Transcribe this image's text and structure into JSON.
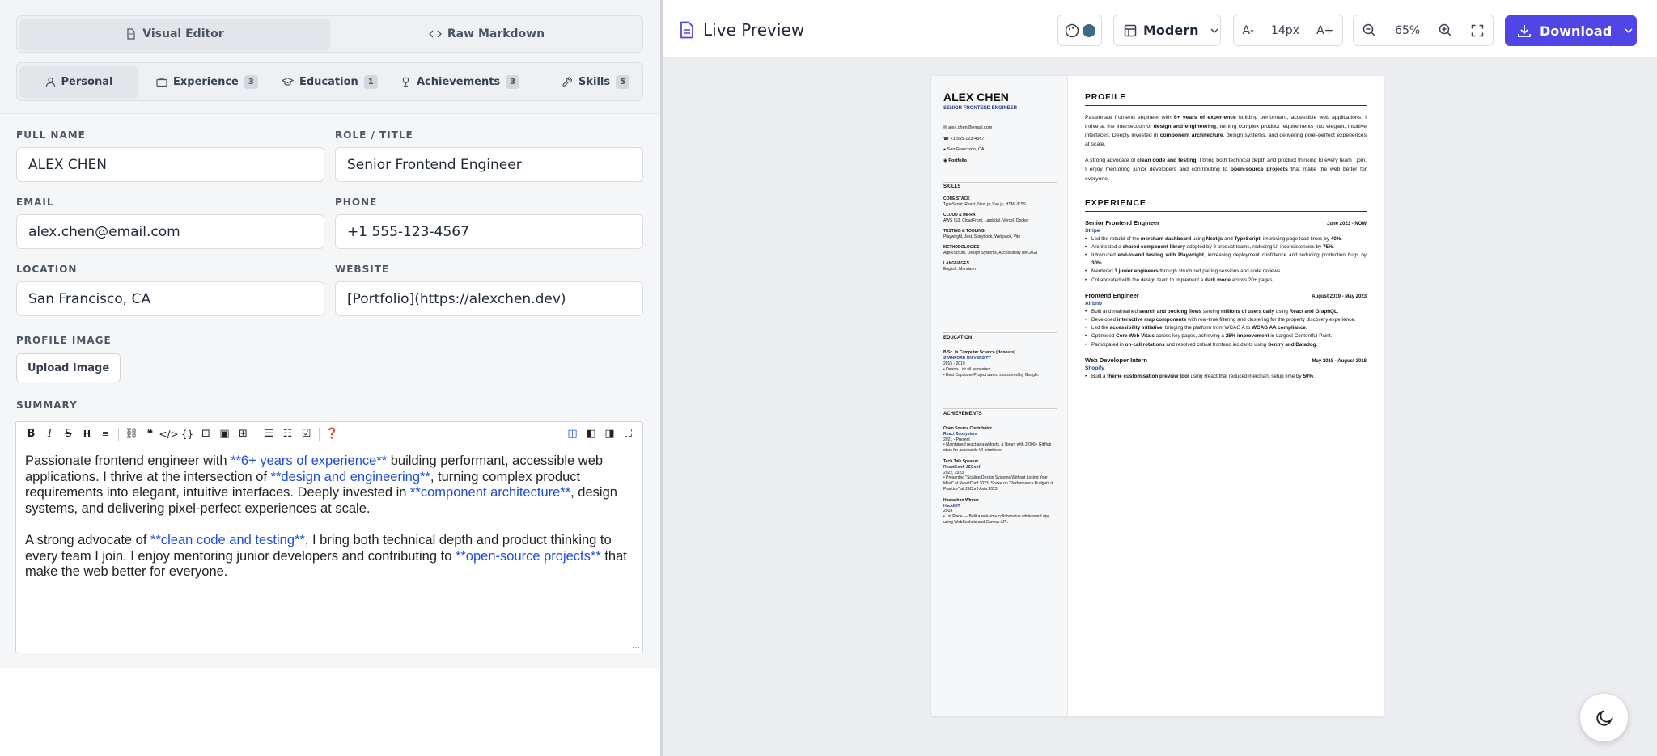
{
  "mode_switch": {
    "visual": "Visual Editor",
    "raw": "Raw Markdown"
  },
  "tabs": [
    {
      "label": "Personal",
      "count": ""
    },
    {
      "label": "Experience",
      "count": "3"
    },
    {
      "label": "Education",
      "count": "1"
    },
    {
      "label": "Achievements",
      "count": "3"
    },
    {
      "label": "Skills",
      "count": "5"
    }
  ],
  "form": {
    "full_name_label": "FULL NAME",
    "full_name": "ALEX CHEN",
    "role_label": "ROLE / TITLE",
    "role": "Senior Frontend Engineer",
    "email_label": "EMAIL",
    "email": "alex.chen@email.com",
    "phone_label": "PHONE",
    "phone": "+1 555-123-4567",
    "location_label": "LOCATION",
    "location": "San Francisco, CA",
    "website_label": "WEBSITE",
    "website": "[Portfolio](https://alexchen.dev)",
    "profile_image_label": "PROFILE IMAGE",
    "upload_button": "Upload Image",
    "summary_label": "SUMMARY"
  },
  "summary": {
    "p1": [
      {
        "t": "Passionate frontend engineer with "
      },
      {
        "t": "**6+ years of experience**",
        "md": true
      },
      {
        "t": " building performant, accessible web applications. I thrive at the intersection of "
      },
      {
        "t": "**design and engineering**",
        "md": true
      },
      {
        "t": ", turning complex product requirements into elegant, intuitive interfaces. Deeply invested in "
      },
      {
        "t": "**component architecture**",
        "md": true
      },
      {
        "t": ", design systems, and delivering pixel-perfect experiences at scale."
      }
    ],
    "p2": [
      {
        "t": "A strong advocate of "
      },
      {
        "t": "**clean code and testing**",
        "md": true
      },
      {
        "t": ", I bring both technical depth and product thinking to every team I join. I enjoy mentoring junior developers and contributing to "
      },
      {
        "t": "**open-source projects**",
        "md": true
      },
      {
        "t": " that make the web better for everyone."
      }
    ]
  },
  "preview": {
    "title": "Live Preview",
    "template": "Modern",
    "font_size": "14px",
    "font_decrease": "A-",
    "font_increase": "A+",
    "zoom": "65%",
    "download": "Download"
  },
  "resume": {
    "name": "ALEX CHEN",
    "role": "SENIOR FRONTEND ENGINEER",
    "contact": [
      "alex.chen@email.com",
      "+1 555-123-4567",
      "San Francisco, CA",
      "Portfolio"
    ],
    "skills_heading": "SKILLS",
    "skills": [
      {
        "cat": "CORE STACK",
        "items": "TypeScript, React, Next.js, Vue.js, HTML/CSS"
      },
      {
        "cat": "CLOUD & INFRA",
        "items": "AWS (S3, CloudFront, Lambda), Vercel, Docker"
      },
      {
        "cat": "TESTING & TOOLING",
        "items": "Playwright, Jest, Storybook, Webpack, Vite"
      },
      {
        "cat": "METHODOLOGIES",
        "items": "Agile/Scrum, Design Systems, Accessibility (WCAG)"
      },
      {
        "cat": "LANGUAGES",
        "items": "English, Mandarin"
      }
    ],
    "education_heading": "EDUCATION",
    "education": {
      "degree": "B.Sc. in Computer Science (Honours)",
      "school": "STANFORD UNIVERSITY",
      "years": "2015 - 2019",
      "bullets": [
        "Dean's List all semesters.",
        "Best Capstone Project award sponsored by Google."
      ]
    },
    "achievements_heading": "ACHIEVEMENTS",
    "achievements": [
      {
        "title": "Open Source Contributor",
        "org": "React Ecosystem",
        "date": "2021 - Present",
        "desc": "Maintained react-aria-widgets, a library with 2,000+ GitHub stars for accessible UI primitives."
      },
      {
        "title": "Tech Talk Speaker",
        "org": "ReactConf, JSConf",
        "date": "2022, 2023",
        "desc": "Presented \"Scaling Design Systems Without Losing Your Mind\" at ReactConf 2023. Spoke on \"Performance Budgets in Practice\" at JSConf Asia 2023."
      },
      {
        "title": "Hackathon Winner",
        "org": "HackMIT",
        "date": "2018",
        "desc": "1st Place — Built a real-time collaborative whiteboard app using WebSockets and Canvas API."
      }
    ],
    "profile_heading": "PROFILE",
    "profile_p1": [
      {
        "t": "Passionate frontend engineer with "
      },
      {
        "t": "6+ years of experience",
        "b": true
      },
      {
        "t": " building performant, accessible web applications. I thrive at the intersection of "
      },
      {
        "t": "design and engineering",
        "b": true
      },
      {
        "t": ", turning complex product requirements into elegant, intuitive interfaces. Deeply invested in "
      },
      {
        "t": "component architecture",
        "b": true
      },
      {
        "t": ", design systems, and delivering pixel-perfect experiences at scale."
      }
    ],
    "profile_p2": [
      {
        "t": "A strong advocate of "
      },
      {
        "t": "clean code and testing",
        "b": true
      },
      {
        "t": ", I bring both technical depth and product thinking to every team I join. I enjoy mentoring junior developers and contributing to "
      },
      {
        "t": "open-source projects",
        "b": true
      },
      {
        "t": " that make the web better for everyone."
      }
    ],
    "experience_heading": "EXPERIENCE",
    "jobs": [
      {
        "title": "Senior Frontend Engineer",
        "company": "Stripe",
        "date": "June 2023 - NOW",
        "bullets": [
          [
            {
              "t": "Led the rebuild of the "
            },
            {
              "t": "merchant dashboard",
              "b": true
            },
            {
              "t": " using "
            },
            {
              "t": "Next.js",
              "b": true
            },
            {
              "t": " and "
            },
            {
              "t": "TypeScript",
              "b": true
            },
            {
              "t": ", improving page load times by "
            },
            {
              "t": "40%",
              "b": true
            },
            {
              "t": "."
            }
          ],
          [
            {
              "t": "Architected a "
            },
            {
              "t": "shared component library",
              "b": true
            },
            {
              "t": " adopted by 8 product teams, reducing UI inconsistencies by "
            },
            {
              "t": "75%",
              "b": true
            },
            {
              "t": "."
            }
          ],
          [
            {
              "t": "Introduced "
            },
            {
              "t": "end-to-end testing with Playwright",
              "b": true
            },
            {
              "t": ", increasing deployment confidence and reducing production bugs by "
            },
            {
              "t": "30%",
              "b": true
            },
            {
              "t": "."
            }
          ],
          [
            {
              "t": "Mentored "
            },
            {
              "t": "3 junior engineers",
              "b": true
            },
            {
              "t": " through structured pairing sessions and code reviews."
            }
          ],
          [
            {
              "t": "Collaborated with the design team to implement a "
            },
            {
              "t": "dark mode",
              "b": true
            },
            {
              "t": " across 20+ pages."
            }
          ]
        ]
      },
      {
        "title": "Frontend Engineer",
        "company": "Airbnb",
        "date": "August 2019 - May 2023",
        "bullets": [
          [
            {
              "t": "Built and maintained "
            },
            {
              "t": "search and booking flows",
              "b": true
            },
            {
              "t": " serving "
            },
            {
              "t": "millions of users daily",
              "b": true
            },
            {
              "t": " using "
            },
            {
              "t": "React and GraphQL",
              "b": true
            },
            {
              "t": "."
            }
          ],
          [
            {
              "t": "Developed "
            },
            {
              "t": "interactive map components",
              "b": true
            },
            {
              "t": " with real-time filtering and clustering for the property discovery experience."
            }
          ],
          [
            {
              "t": "Led the "
            },
            {
              "t": "accessibility initiative",
              "b": true
            },
            {
              "t": ", bringing the platform from WCAG A to "
            },
            {
              "t": "WCAG AA compliance",
              "b": true
            },
            {
              "t": "."
            }
          ],
          [
            {
              "t": "Optimised "
            },
            {
              "t": "Core Web Vitals",
              "b": true
            },
            {
              "t": " across key pages, achieving a "
            },
            {
              "t": "25% improvement",
              "b": true
            },
            {
              "t": " in Largest Contentful Paint."
            }
          ],
          [
            {
              "t": "Participated in "
            },
            {
              "t": "on-call rotations",
              "b": true
            },
            {
              "t": " and resolved critical frontend incidents using "
            },
            {
              "t": "Sentry and Datadog",
              "b": true
            },
            {
              "t": "."
            }
          ]
        ]
      },
      {
        "title": "Web Developer Intern",
        "company": "Shopify",
        "date": "May 2018 - August 2018",
        "bullets": [
          [
            {
              "t": "Built a "
            },
            {
              "t": "theme customisation preview tool",
              "b": true
            },
            {
              "t": " using React that reduced merchant setup time by "
            },
            {
              "t": "50%",
              "b": true
            },
            {
              "t": "."
            }
          ]
        ]
      }
    ]
  },
  "colors": {
    "accent": "#4f46e5",
    "link": "#1d4ed8",
    "resume_blue": "#1e3a8a"
  }
}
